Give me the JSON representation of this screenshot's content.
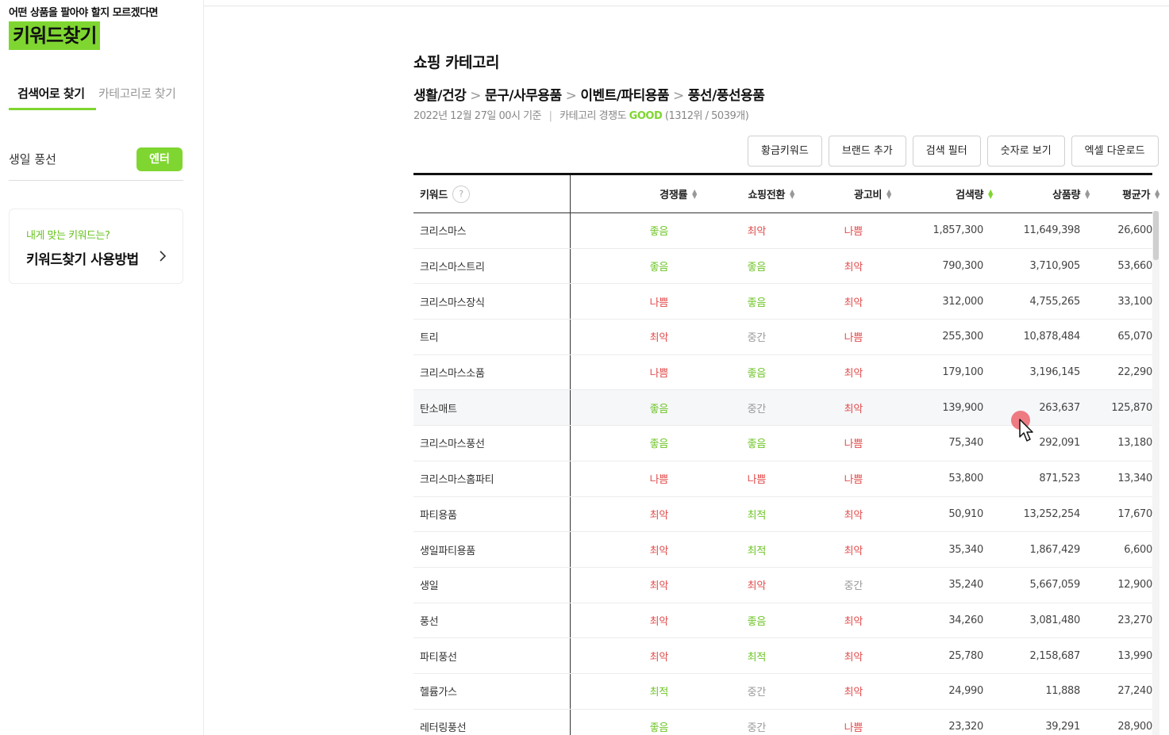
{
  "sidebar": {
    "tagline": "어떤 상품을 팔아야 할지 모르겠다면",
    "logo": "키워드찾기",
    "tabs": [
      {
        "label": "검색어로 찾기"
      },
      {
        "label": "카테고리로 찾기"
      }
    ],
    "search": {
      "value": "생일 풍선",
      "button": "엔터"
    },
    "help": {
      "sub": "내게 맞는 키워드는?",
      "title": "키워드찾기 사용방법"
    }
  },
  "main": {
    "title": "쇼핑 카테고리",
    "breadcrumb": [
      "생활/건강",
      "문구/사무용품",
      "이벤트/파티용품",
      "풍선/풍선용품"
    ],
    "breadcrumb_sep": ">",
    "meta": {
      "date": "2022년 12월 27일 00시 기준",
      "divider": "|",
      "comp_label": "카테고리 경쟁도",
      "comp_value": "GOOD",
      "comp_rank": "(1312위 / 5039개)"
    },
    "buttons": [
      "황금키워드",
      "브랜드 추가",
      "검색 필터",
      "숫자로 보기",
      "엑셀 다운로드"
    ]
  },
  "table": {
    "headers": [
      "키워드",
      "경쟁률",
      "쇼핑전환",
      "광고비",
      "검색량",
      "상품량",
      "평균가"
    ],
    "help_icon": "?",
    "rows": [
      [
        "크리스마스",
        "좋음",
        "최악",
        "나쁨",
        "1,857,300",
        "11,649,398",
        "26,600"
      ],
      [
        "크리스마스트리",
        "좋음",
        "좋음",
        "최악",
        "790,300",
        "3,710,905",
        "53,660"
      ],
      [
        "크리스마스장식",
        "나쁨",
        "좋음",
        "최악",
        "312,000",
        "4,755,265",
        "33,100"
      ],
      [
        "트리",
        "최악",
        "중간",
        "나쁨",
        "255,300",
        "10,878,484",
        "65,070"
      ],
      [
        "크리스마스소품",
        "나쁨",
        "좋음",
        "최악",
        "179,100",
        "3,196,145",
        "22,290"
      ],
      [
        "탄소매트",
        "좋음",
        "중간",
        "최악",
        "139,900",
        "263,637",
        "125,870"
      ],
      [
        "크리스마스풍선",
        "좋음",
        "좋음",
        "나쁨",
        "75,340",
        "292,091",
        "13,180"
      ],
      [
        "크리스마스홈파티",
        "나쁨",
        "나쁨",
        "나쁨",
        "53,800",
        "871,523",
        "13,340"
      ],
      [
        "파티용품",
        "최악",
        "최적",
        "최악",
        "50,910",
        "13,252,254",
        "17,670"
      ],
      [
        "생일파티용품",
        "최악",
        "최적",
        "최악",
        "35,340",
        "1,867,429",
        "6,600"
      ],
      [
        "생일",
        "최악",
        "최악",
        "중간",
        "35,240",
        "5,667,059",
        "12,900"
      ],
      [
        "풍선",
        "최악",
        "좋음",
        "최악",
        "34,260",
        "3,081,480",
        "23,270"
      ],
      [
        "파티풍선",
        "최악",
        "최적",
        "최악",
        "25,780",
        "2,158,687",
        "13,990"
      ],
      [
        "헬륨가스",
        "최적",
        "중간",
        "최악",
        "24,990",
        "11,888",
        "27,240"
      ],
      [
        "레터링풍선",
        "좋음",
        "중간",
        "나쁨",
        "23,320",
        "39,291",
        "28,900"
      ]
    ]
  },
  "colors": {
    "accent": "#7fd630",
    "good": "#6cc424",
    "bad": "#e24b4b",
    "mid": "#999999"
  }
}
